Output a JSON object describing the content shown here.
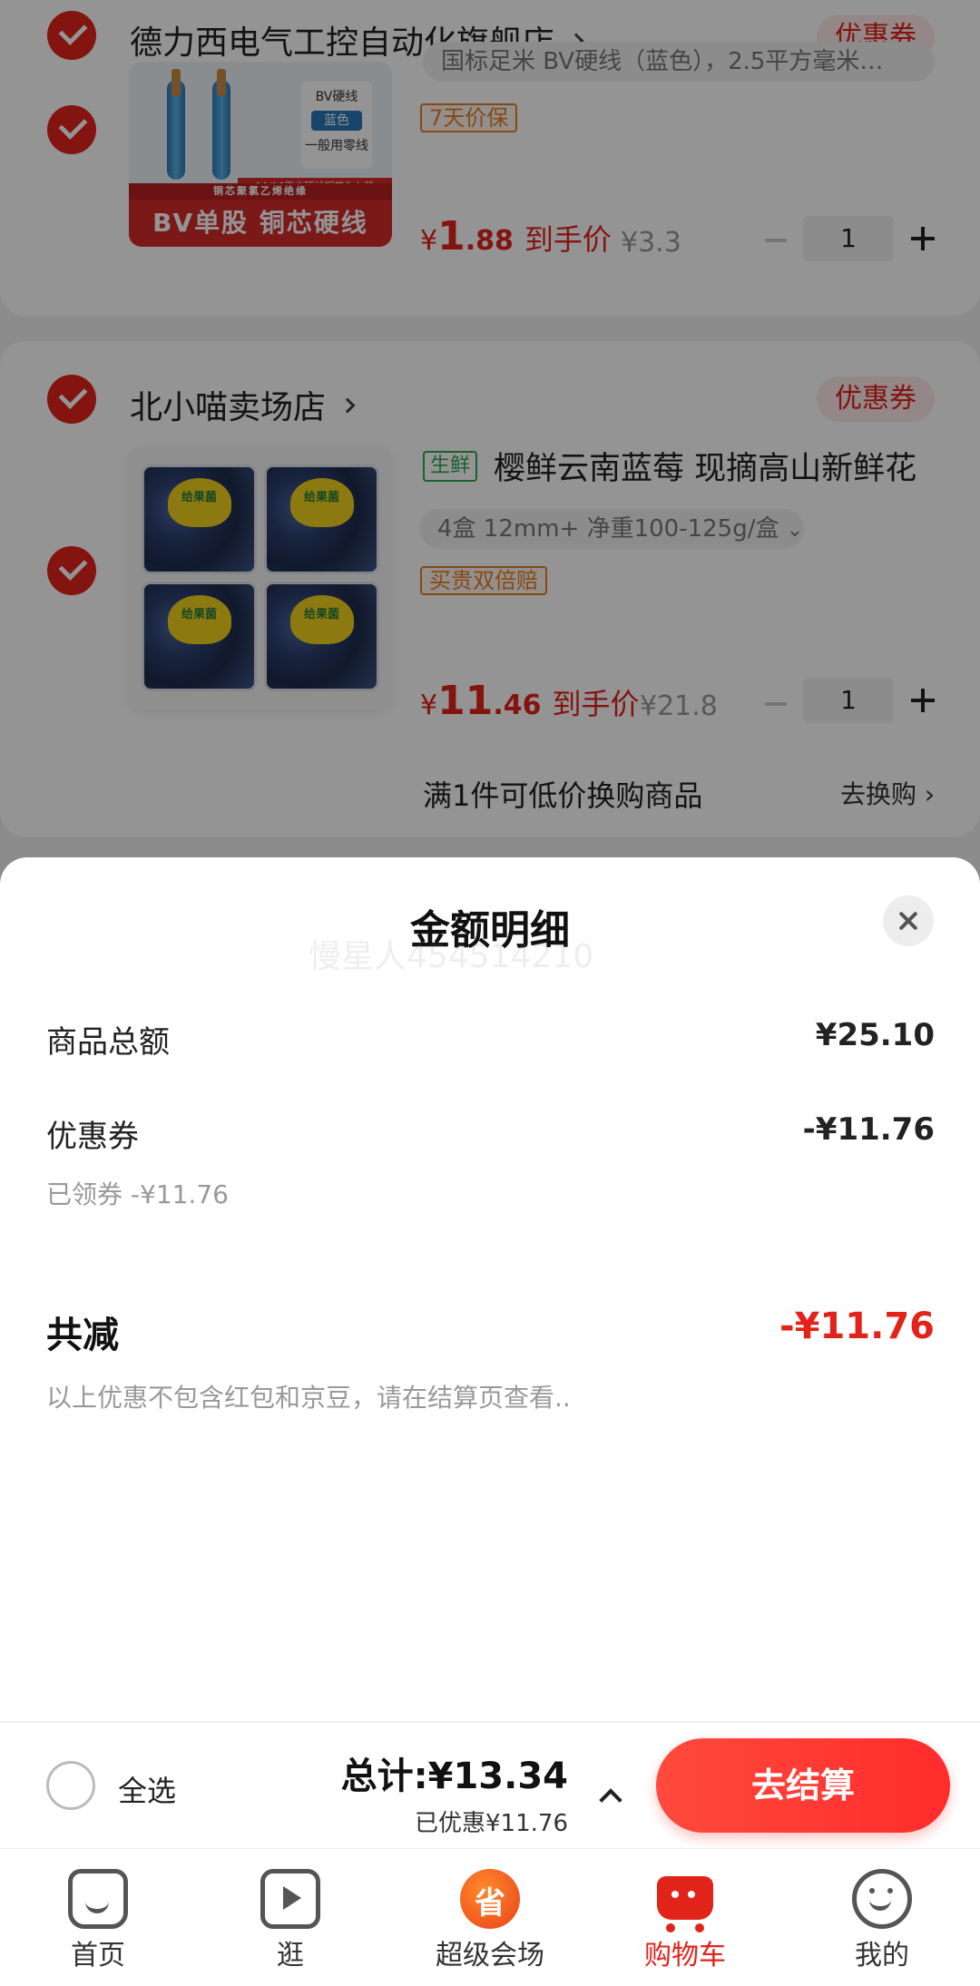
{
  "cart": {
    "shop1": {
      "name": "德力西电气工控自动化旗舰店",
      "coupon_label": "优惠券",
      "item": {
        "spec": "国标足米 BV硬线（蓝色），2.5平方毫米…",
        "badge": "7天价保",
        "image_text": {
          "tag_title": "BV硬线",
          "tag_color": "蓝色",
          "tag_use": "一般用零线",
          "strip": "10/16平方硬线铜芯为七股",
          "sub_strip": "铜芯聚氯乙烯绝缘",
          "banner": "BV单股 铜芯硬线"
        },
        "price_symbol": "¥",
        "price_int": "1",
        "price_dec": ".88",
        "price_label": "到手价",
        "orig_price": "¥3.3",
        "qty": "1"
      }
    },
    "shop2": {
      "name": "北小喵卖场店",
      "coupon_label": "优惠券",
      "item": {
        "fresh_tag": "生鲜",
        "title": "樱鲜云南蓝莓 现摘高山新鲜花",
        "spec": "4盒 12mm+ 净重100-125g/盒",
        "badge": "买贵双倍赔",
        "box_label": "给果菌",
        "price_symbol": "¥",
        "price_int": "11",
        "price_dec": ".46",
        "price_label": "到手价",
        "orig_price": "¥21.8",
        "qty": "1"
      },
      "swap_text": "满1件可低价换购商品",
      "swap_link": "去换购"
    }
  },
  "sheet": {
    "title": "金额明细",
    "watermark": "慢星人454514210",
    "rows": [
      {
        "label": "商品总额",
        "value": "¥25.10"
      },
      {
        "label": "优惠券",
        "value": "-¥11.76",
        "sub": "已领券 -¥11.76"
      }
    ],
    "total_label": "共减",
    "total_value": "-¥11.76",
    "note": "以上优惠不包含红包和京豆，请在结算页查看.."
  },
  "checkout": {
    "select_all": "全选",
    "total": "总计:¥13.34",
    "discount": "已优惠¥11.76",
    "button": "去结算"
  },
  "tabs": [
    {
      "label": "首页",
      "icon": "home-icon"
    },
    {
      "label": "逛",
      "icon": "video-play-icon"
    },
    {
      "label": "超级会场",
      "icon": "super-venue-icon"
    },
    {
      "label": "购物车",
      "icon": "cart-icon",
      "active": true
    },
    {
      "label": "我的",
      "icon": "smiley-profile-icon"
    }
  ],
  "colors": {
    "accent": "#e2231a",
    "checkout_button": "#ff3b30",
    "badge_orange": "#e47f2a",
    "fresh_green": "#2fa84f"
  }
}
